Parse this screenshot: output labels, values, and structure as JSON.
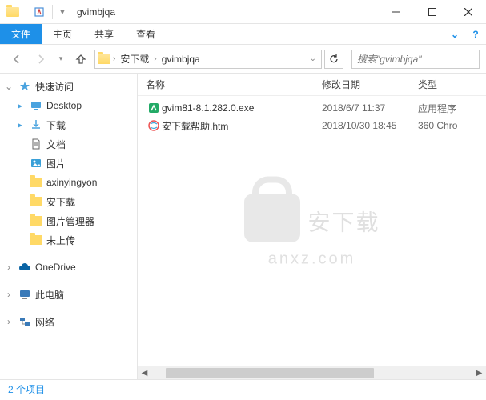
{
  "titlebar": {
    "title": "gvimbjqa"
  },
  "ribbon": {
    "file": "文件",
    "home": "主页",
    "share": "共享",
    "view": "查看"
  },
  "breadcrumb": {
    "anxia": "安下载",
    "folder": "gvimbjqa"
  },
  "search": {
    "placeholder": "搜索\"gvimbjqa\""
  },
  "columns": {
    "name": "名称",
    "date": "修改日期",
    "type": "类型"
  },
  "sidebar": {
    "quick": "快速访问",
    "desktop": "Desktop",
    "downloads": "下载",
    "documents": "文档",
    "pictures": "图片",
    "axinyingyon": "axinyingyon",
    "anxia": "安下载",
    "picmgr": "图片管理器",
    "notup": "未上传",
    "onedrive": "OneDrive",
    "thispc": "此电脑",
    "network": "网络"
  },
  "files": [
    {
      "name": "gvim81-8.1.282.0.exe",
      "date": "2018/6/7 11:37",
      "type": "应用程序"
    },
    {
      "name": "安下载帮助.htm",
      "date": "2018/10/30 18:45",
      "type": "360 Chro"
    }
  ],
  "watermark": {
    "text": "安下载",
    "sub": "anxz.com"
  },
  "status": {
    "items": "2 个项目"
  }
}
